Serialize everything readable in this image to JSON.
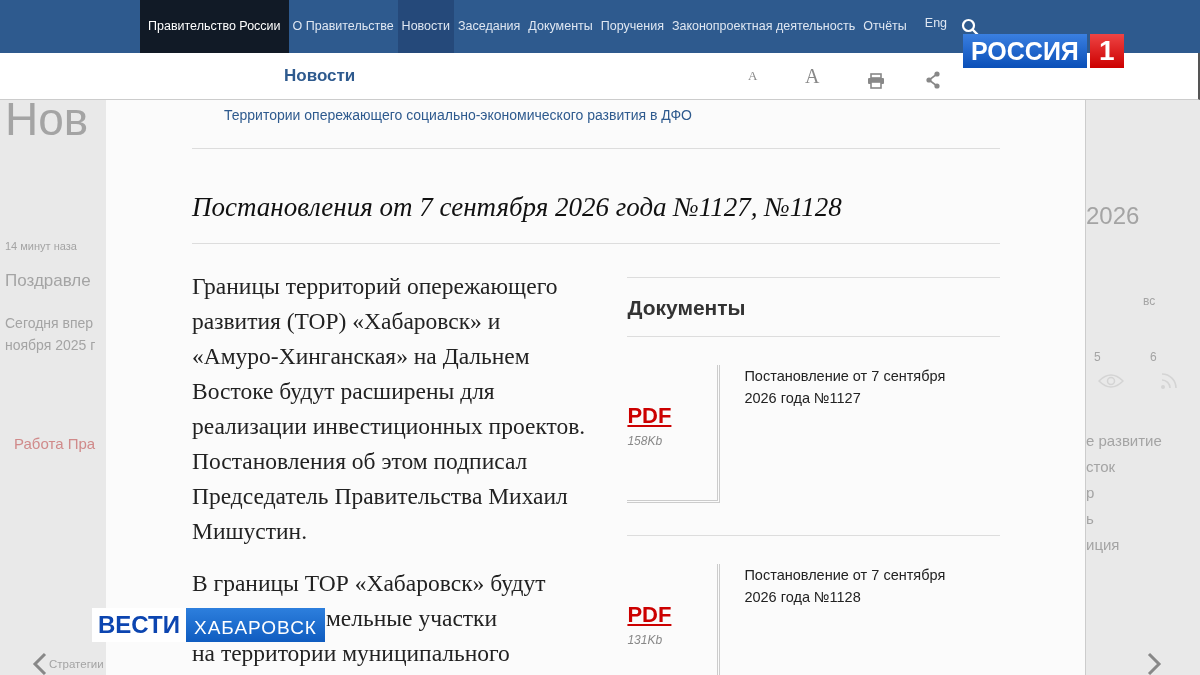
{
  "topnav": {
    "items": [
      {
        "label": "Правительство России",
        "kind": "home",
        "selected": false
      },
      {
        "label": "О Правительстве",
        "kind": "link",
        "selected": false
      },
      {
        "label": "Новости",
        "kind": "link",
        "selected": true
      },
      {
        "label": "Заседания",
        "kind": "link",
        "selected": false
      },
      {
        "label": "Документы",
        "kind": "link",
        "selected": false
      },
      {
        "label": "Поручения",
        "kind": "link",
        "selected": false
      },
      {
        "label": "Законопроектная деятельность",
        "kind": "link",
        "selected": false
      },
      {
        "label": "Отчёты",
        "kind": "link",
        "selected": false
      },
      {
        "label": "Eng",
        "kind": "lang",
        "selected": false
      }
    ]
  },
  "header": {
    "title": "Новости",
    "font_small": "A",
    "font_large": "A"
  },
  "background": {
    "left": [
      {
        "text": "Нов",
        "kind": "heading"
      },
      {
        "text": "14 минут наза",
        "kind": "time"
      },
      {
        "text": "Поздравле",
        "kind": "title"
      },
      {
        "text": "Сегодня впер",
        "kind": "lead"
      },
      {
        "text": "ноября 2025 г",
        "kind": "lead"
      },
      {
        "text": "Работа Пра",
        "kind": "tag"
      },
      {
        "text": "Стратегии",
        "kind": "footer"
      }
    ],
    "right": [
      {
        "text": "2026",
        "kind": "year"
      },
      {
        "text": "вс",
        "kind": "weekday"
      },
      {
        "text": "5",
        "kind": "day"
      },
      {
        "text": "6",
        "kind": "day"
      },
      {
        "text": "е развитие",
        "kind": "item"
      },
      {
        "text": "сток",
        "kind": "item"
      },
      {
        "text": "р",
        "kind": "item"
      },
      {
        "text": "ь",
        "kind": "item"
      },
      {
        "text": "иция",
        "kind": "item"
      }
    ]
  },
  "article": {
    "breadcrumb": "Территории опережающего социально-экономического развития в ДФО",
    "title": "Постановления от 7 сентября 2026 года №1127, №1128",
    "paragraphs": [
      {
        "lines": [
          "Границы территорий опережающего развития (ТОР) «Хабаровск» и «Амуро-Хинганская» на Дальнем Востоке будут расширены для реализации инвестиционных проектов. Постановления об этом подписал Председатель Правительства Михаил Мишустин."
        ]
      },
      {
        "lines": [
          "В границы ТОР «Хабаровск» будут",
          "мельные участки",
          "на территории муниципального"
        ]
      }
    ],
    "documents": {
      "heading": "Документы",
      "items": [
        {
          "format": "PDF",
          "size": "158Kb",
          "title": "Постановление от 7 сентября 2026 года №1127"
        },
        {
          "format": "PDF",
          "size": "131Kb",
          "title": "Постановление от 7 сентября 2026 года №1128"
        }
      ]
    }
  },
  "overlays": {
    "channel_logo": {
      "name": "РОССИЯ",
      "number": "1"
    },
    "caption": {
      "program": "ВЕСТИ",
      "region": "ХАБАРОВСК"
    }
  }
}
